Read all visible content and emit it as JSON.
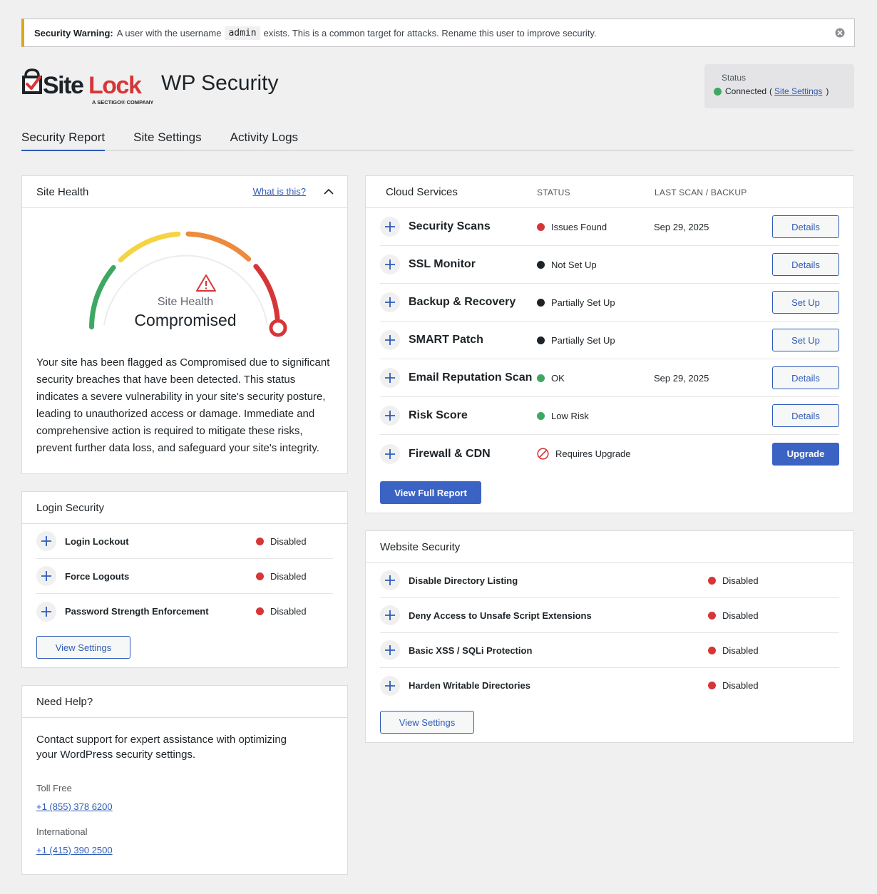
{
  "notice": {
    "title": "Security Warning:",
    "pre": "A user with the username",
    "code": "admin",
    "post": "exists. This is a common target for attacks. Rename this user to improve security."
  },
  "header": {
    "logo_text": "SiteLock",
    "logo_sub": "A SECTIGO COMPANY",
    "product_title": "WP Security"
  },
  "status_box": {
    "label": "Status",
    "value": "Connected",
    "link": "Site Settings",
    "open_paren": "(",
    "close_paren": ")"
  },
  "tabs": [
    "Security Report",
    "Site Settings",
    "Activity Logs"
  ],
  "site_health": {
    "title": "Site Health",
    "help_link": "What is this?",
    "gauge_label": "Site Health",
    "gauge_value": "Compromised",
    "description": "Your site has been flagged as Compromised due to significant security breaches that have been detected. This status indicates a severe vulnerability in your site's security posture, leading to unauthorized access or damage. Immediate and comprehensive action is required to mitigate these risks, prevent further data loss, and safeguard your site's integrity."
  },
  "login_security": {
    "title": "Login Security",
    "items": [
      {
        "name": "Login Lockout",
        "status": "Disabled"
      },
      {
        "name": "Force Logouts",
        "status": "Disabled"
      },
      {
        "name": "Password Strength Enforcement",
        "status": "Disabled"
      }
    ],
    "button": "View Settings"
  },
  "help": {
    "title": "Need Help?",
    "text": "Contact support for expert assistance with optimizing your WordPress security settings.",
    "toll_free_label": "Toll Free",
    "toll_free": "+1 (855) 378 6200",
    "intl_label": "International",
    "intl": "+1 (415) 390 2500"
  },
  "cloud_services": {
    "title": "Cloud Services",
    "col_status": "STATUS",
    "col_last": "LAST SCAN / BACKUP",
    "items": [
      {
        "name": "Security Scans",
        "status": "Issues Found",
        "date": "Sep 29, 2025",
        "action": "Details"
      },
      {
        "name": "SSL Monitor",
        "status": "Not Set Up",
        "date": "",
        "action": "Details"
      },
      {
        "name": "Backup & Recovery",
        "status": "Partially Set Up",
        "date": "",
        "action": "Set Up"
      },
      {
        "name": "SMART Patch",
        "status": "Partially Set Up",
        "date": "",
        "action": "Set Up"
      },
      {
        "name": "Email Reputation Scan",
        "status": "OK",
        "date": "Sep 29, 2025",
        "action": "Details"
      },
      {
        "name": "Risk Score",
        "status": "Low Risk",
        "date": "",
        "action": "Details"
      },
      {
        "name": "Firewall & CDN",
        "status": "Requires Upgrade",
        "date": "",
        "action": "Upgrade"
      }
    ],
    "button": "View Full Report"
  },
  "website_security": {
    "title": "Website Security",
    "items": [
      {
        "name": "Disable Directory Listing",
        "status": "Disabled"
      },
      {
        "name": "Deny Access to Unsafe Script Extensions",
        "status": "Disabled"
      },
      {
        "name": "Basic XSS / SQLi Protection",
        "status": "Disabled"
      },
      {
        "name": "Harden Writable Directories",
        "status": "Disabled"
      }
    ],
    "button": "View Settings"
  },
  "colors": {
    "accent": "#2f5bb7",
    "red": "#d63638",
    "green": "#3ea862",
    "warning": "#dba617"
  }
}
